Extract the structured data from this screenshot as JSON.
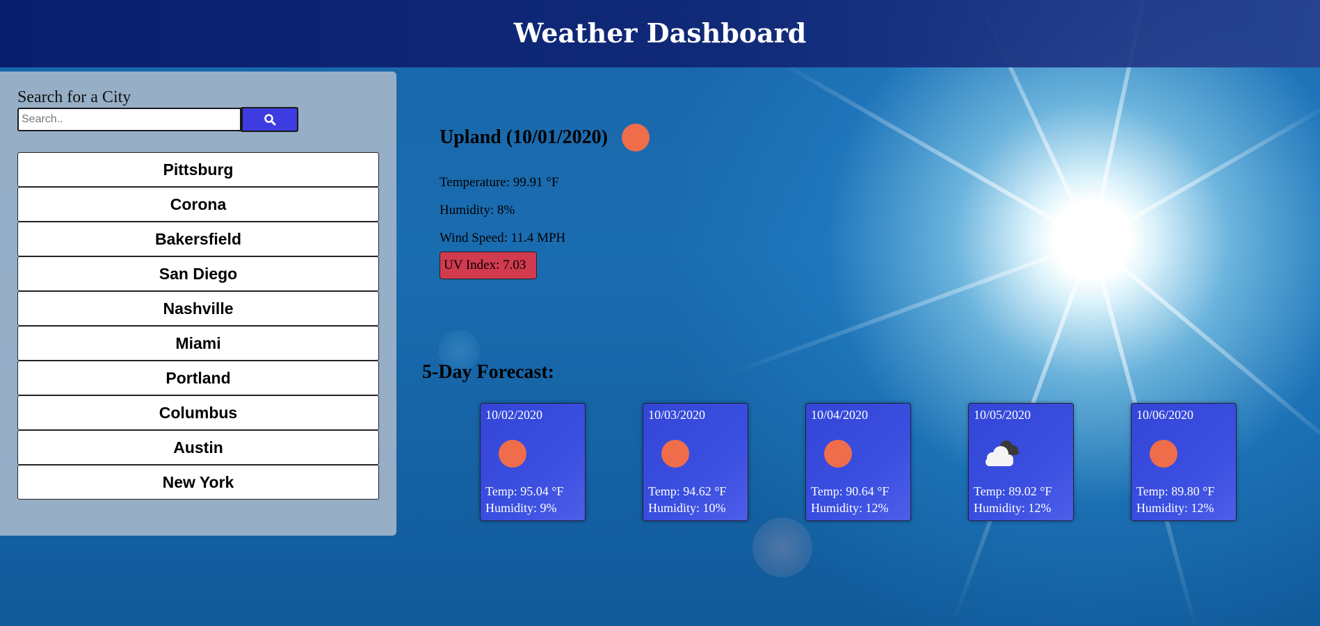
{
  "header": {
    "title": "Weather Dashboard"
  },
  "search": {
    "label": "Search for a City",
    "placeholder": "Search..",
    "value": "",
    "button_icon": "search-icon"
  },
  "cities": [
    "Pittsburg",
    "Corona",
    "Bakersfield",
    "San Diego",
    "Nashville",
    "Miami",
    "Portland",
    "Columbus",
    "Austin",
    "New York"
  ],
  "current": {
    "title": "Upland (10/01/2020)",
    "icon": "sun-icon",
    "temperature": "Temperature: 99.91 °F",
    "humidity": "Humidity: 8%",
    "wind": "Wind Speed: 11.4 MPH",
    "uv": "UV Index: 7.03",
    "uv_color": "#d23a4e"
  },
  "forecast": {
    "title": "5-Day Forecast:",
    "days": [
      {
        "date": "10/02/2020",
        "icon": "sun-icon",
        "temp": "Temp: 95.04 °F",
        "humidity": "Humidity: 9%"
      },
      {
        "date": "10/03/2020",
        "icon": "sun-icon",
        "temp": "Temp: 94.62 °F",
        "humidity": "Humidity: 10%"
      },
      {
        "date": "10/04/2020",
        "icon": "sun-icon",
        "temp": "Temp: 90.64 °F",
        "humidity": "Humidity: 12%"
      },
      {
        "date": "10/05/2020",
        "icon": "cloud-icon",
        "temp": "Temp: 89.02 °F",
        "humidity": "Humidity: 12%"
      },
      {
        "date": "10/06/2020",
        "icon": "sun-icon",
        "temp": "Temp: 89.80 °F",
        "humidity": "Humidity: 12%"
      }
    ]
  },
  "colors": {
    "header_bg": "#0a1e6e",
    "search_button": "#3c3ce0",
    "card_bg": "#3346d8",
    "sun": "#ef6d4a"
  }
}
